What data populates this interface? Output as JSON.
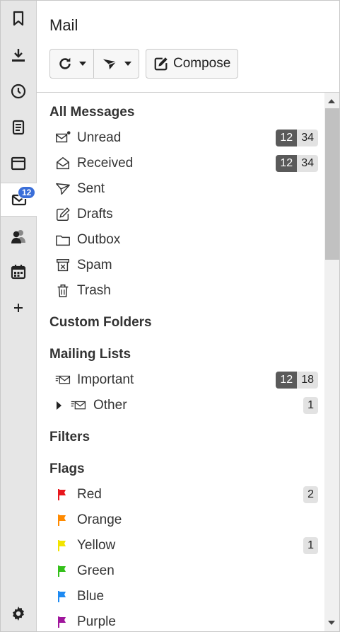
{
  "panel": {
    "title": "Mail"
  },
  "toolbar": {
    "compose_label": "Compose"
  },
  "iconbar": {
    "items": [
      "bookmarks-icon",
      "downloads-icon",
      "history-icon",
      "notes-icon",
      "window-icon",
      "mail-icon",
      "contacts-icon",
      "calendar-icon",
      "add-icon"
    ],
    "mail_badge": "12",
    "settings": "settings-icon"
  },
  "sections": {
    "all_messages": "All Messages",
    "custom_folders": "Custom Folders",
    "mailing_lists": "Mailing Lists",
    "filters": "Filters",
    "flags": "Flags"
  },
  "folders": [
    {
      "label": "Unread",
      "icon": "unread-envelope-icon",
      "unread": "12",
      "total": "34"
    },
    {
      "label": "Received",
      "icon": "open-envelope-icon",
      "unread": "12",
      "total": "34"
    },
    {
      "label": "Sent",
      "icon": "send-icon"
    },
    {
      "label": "Drafts",
      "icon": "edit-icon"
    },
    {
      "label": "Outbox",
      "icon": "folder-icon"
    },
    {
      "label": "Spam",
      "icon": "spam-bin-icon"
    },
    {
      "label": "Trash",
      "icon": "trash-icon"
    }
  ],
  "mailing_lists": [
    {
      "label": "Important",
      "icon": "mailing-list-icon",
      "unread": "12",
      "total": "18"
    },
    {
      "label": "Other",
      "icon": "mailing-list-icon",
      "total": "1"
    }
  ],
  "flags": [
    {
      "label": "Red",
      "color": "#e8171d",
      "count": "2"
    },
    {
      "label": "Orange",
      "color": "#ff8a00"
    },
    {
      "label": "Yellow",
      "color": "#f2e400",
      "count": "1"
    },
    {
      "label": "Green",
      "color": "#34c01a"
    },
    {
      "label": "Blue",
      "color": "#1e8af2"
    },
    {
      "label": "Purple",
      "color": "#a0169c"
    }
  ]
}
